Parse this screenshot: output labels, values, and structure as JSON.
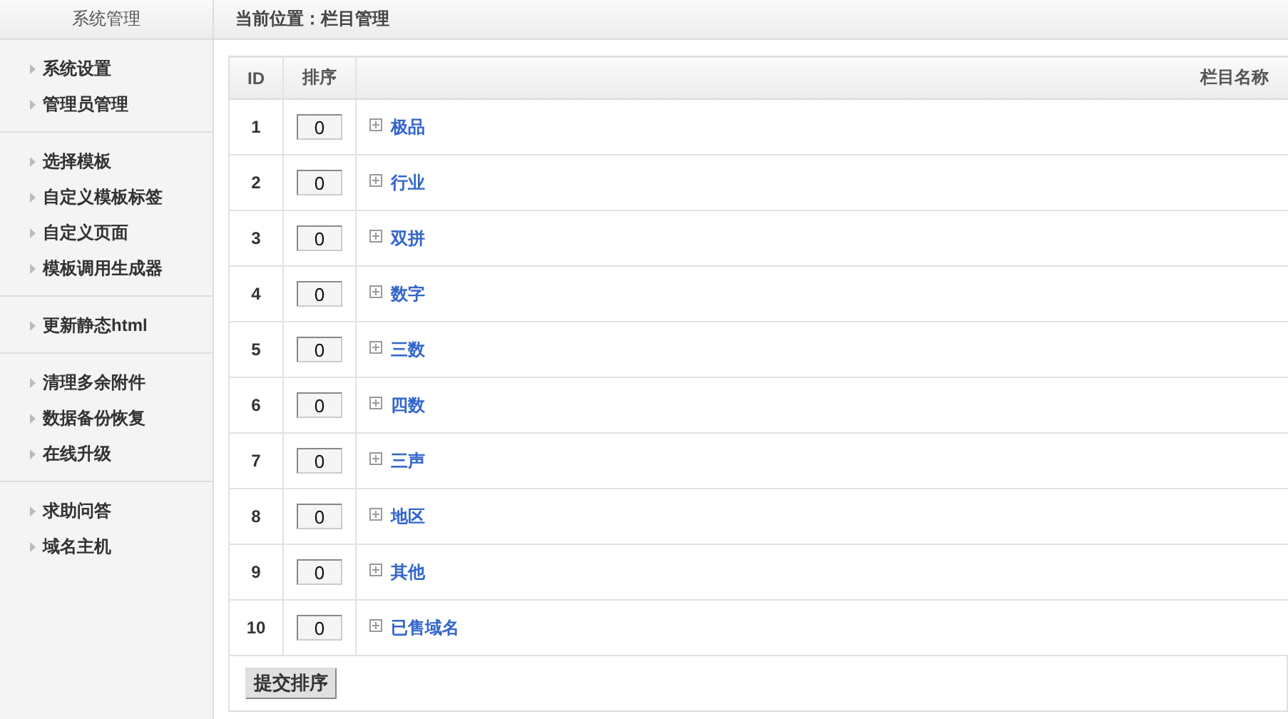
{
  "sidebar": {
    "title": "系统管理",
    "groups": [
      {
        "items": [
          "系统设置",
          "管理员管理"
        ]
      },
      {
        "items": [
          "选择模板",
          "自定义模板标签",
          "自定义页面",
          "模板调用生成器"
        ]
      },
      {
        "items": [
          "更新静态html"
        ]
      },
      {
        "items": [
          "清理多余附件",
          "数据备份恢复",
          "在线升级"
        ]
      },
      {
        "items": [
          "求助问答",
          "域名主机"
        ]
      }
    ]
  },
  "breadcrumb": "当前位置：栏目管理",
  "table": {
    "columns": [
      "ID",
      "排序",
      "栏目名称"
    ],
    "rows": [
      {
        "id": "1",
        "order": "0",
        "name": "极品"
      },
      {
        "id": "2",
        "order": "0",
        "name": "行业"
      },
      {
        "id": "3",
        "order": "0",
        "name": "双拼"
      },
      {
        "id": "4",
        "order": "0",
        "name": "数字"
      },
      {
        "id": "5",
        "order": "0",
        "name": "三数"
      },
      {
        "id": "6",
        "order": "0",
        "name": "四数"
      },
      {
        "id": "7",
        "order": "0",
        "name": "三声"
      },
      {
        "id": "8",
        "order": "0",
        "name": "地区"
      },
      {
        "id": "9",
        "order": "0",
        "name": "其他"
      },
      {
        "id": "10",
        "order": "0",
        "name": "已售域名"
      }
    ],
    "submit": "提交排序"
  }
}
